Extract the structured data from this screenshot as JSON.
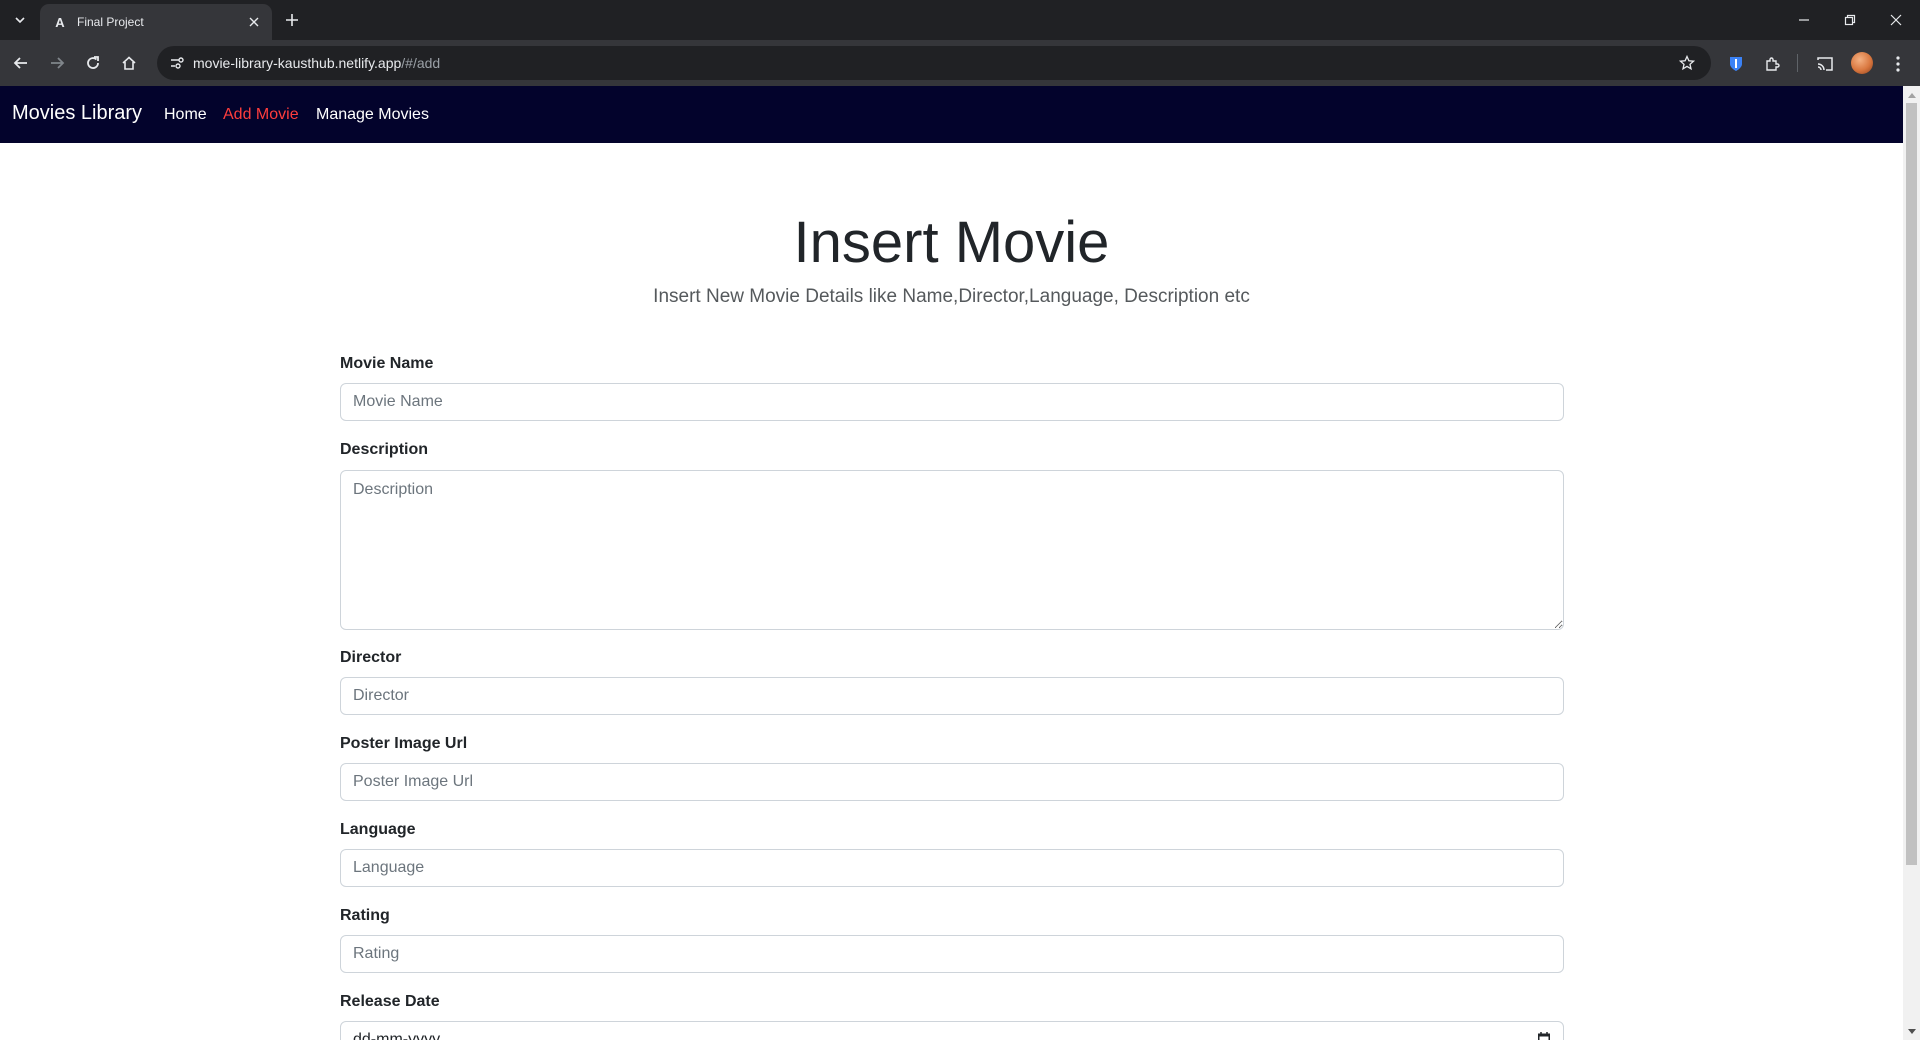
{
  "browser": {
    "tab_title": "Final Project",
    "url_host": "movie-library-kausthub.netlify.app",
    "url_path": "/#/add",
    "icons": [
      "tab-list-icon",
      "angular-favicon-icon",
      "close-icon",
      "plus-icon",
      "minimize-icon",
      "restore-icon",
      "close-window-icon",
      "back-icon",
      "forward-icon",
      "reload-icon",
      "home-icon",
      "site-info-icon",
      "star-icon",
      "shield-extension-icon",
      "puzzle-extension-icon",
      "cast-icon",
      "kebab-menu-icon"
    ]
  },
  "navbar": {
    "brand": "Movies Library",
    "links": [
      "Home",
      "Add Movie",
      "Manage Movies"
    ],
    "active_link": "Add Movie",
    "background": "#03032c",
    "active_color": "#ff3d3d"
  },
  "page": {
    "title": "Insert Movie",
    "subtitle": "Insert New Movie Details like Name,Director,Language, Description etc"
  },
  "form": {
    "movie_name": {
      "label": "Movie Name",
      "placeholder": "Movie Name",
      "value": ""
    },
    "description": {
      "label": "Description",
      "placeholder": "Description",
      "value": ""
    },
    "director": {
      "label": "Director",
      "placeholder": "Director",
      "value": ""
    },
    "poster": {
      "label": "Poster Image Url",
      "placeholder": "Poster Image Url",
      "value": ""
    },
    "language": {
      "label": "Language",
      "placeholder": "Language",
      "value": ""
    },
    "rating": {
      "label": "Rating",
      "placeholder": "Rating",
      "value": ""
    },
    "release_date": {
      "label": "Release Date",
      "placeholder": "dd-mm-yyyy"
    }
  }
}
